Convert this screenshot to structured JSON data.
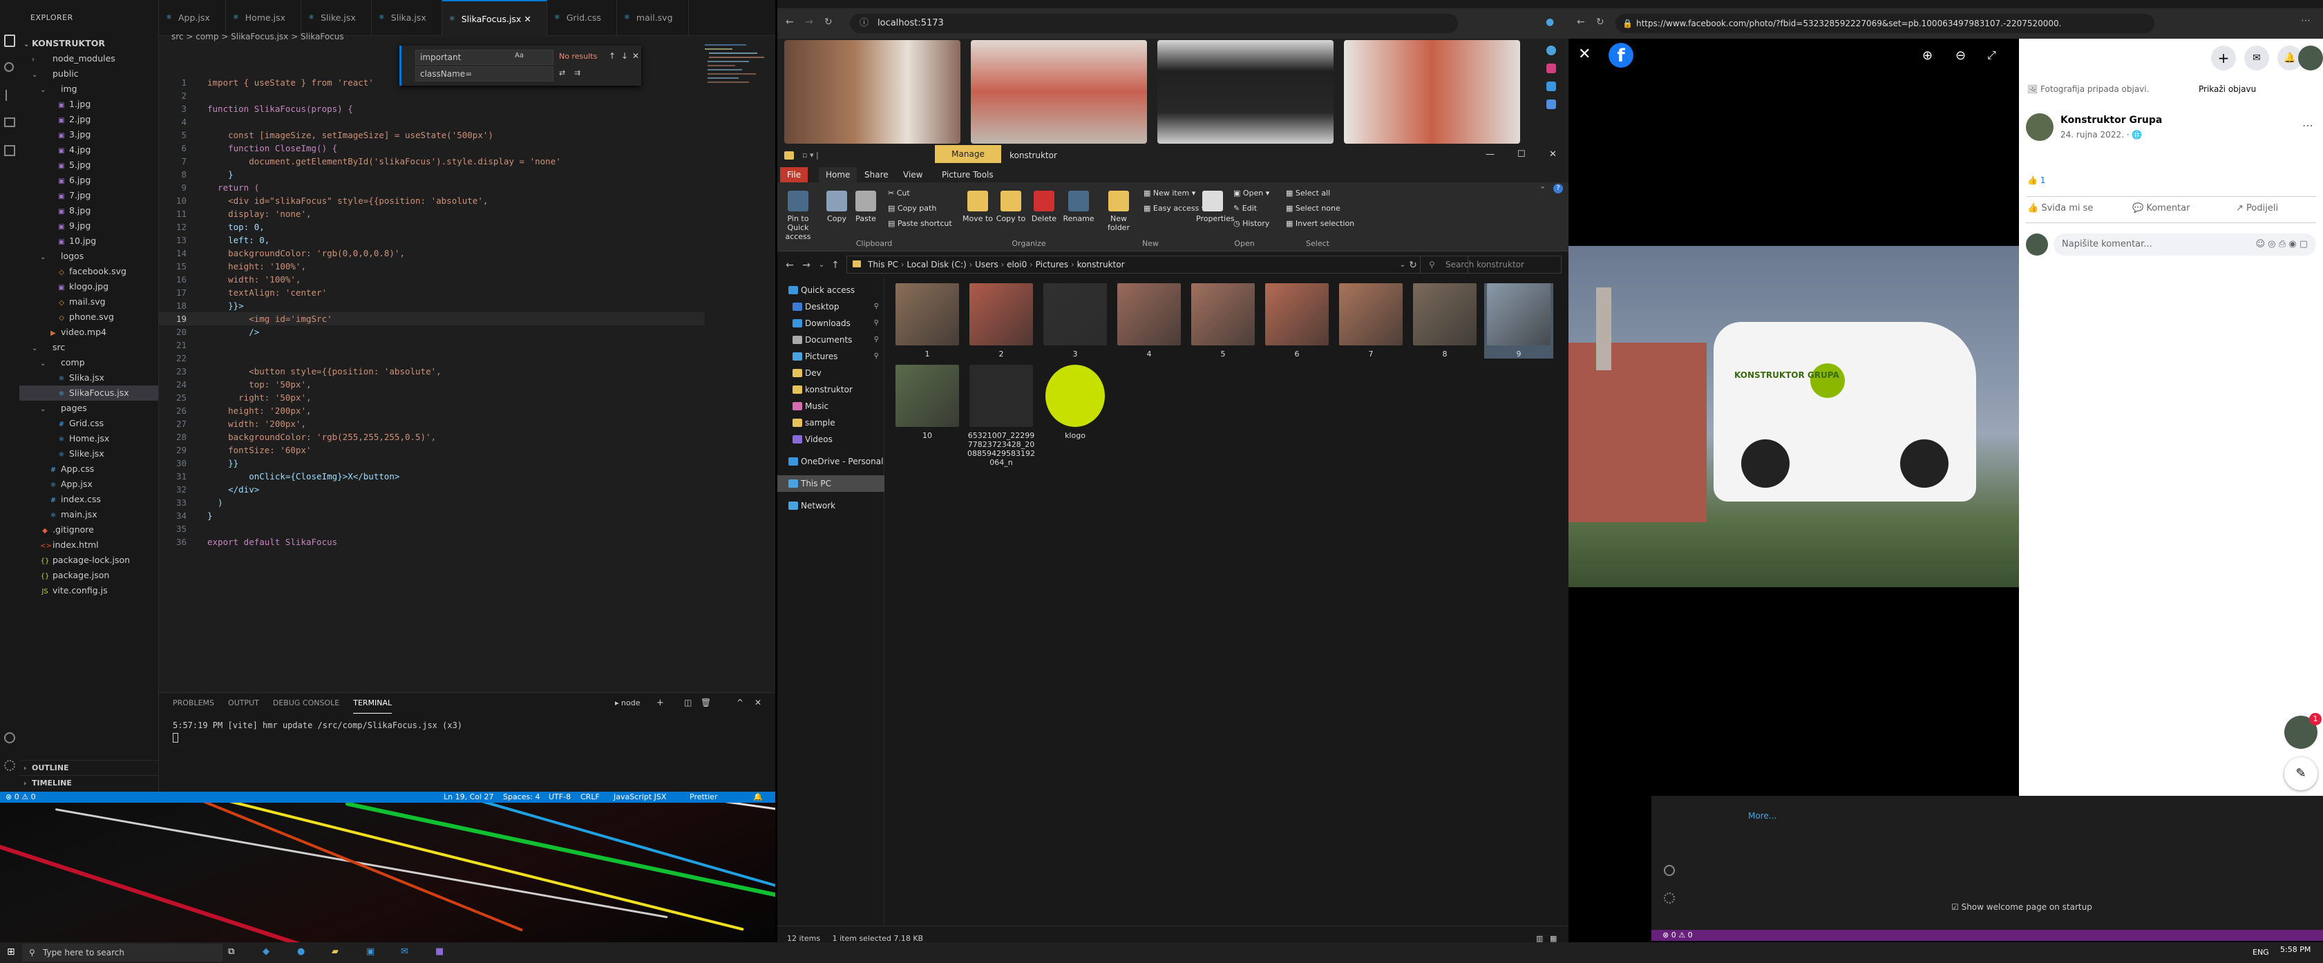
{
  "vscode": {
    "explorer_title": "EXPLORER",
    "project": "KONSTRUKTOR",
    "tree": [
      {
        "label": "node_modules",
        "depth": 1,
        "kind": "folder",
        "open": false
      },
      {
        "label": "public",
        "depth": 1,
        "kind": "folder",
        "open": true
      },
      {
        "label": "img",
        "depth": 2,
        "kind": "folder",
        "open": true
      },
      {
        "label": "1.jpg",
        "depth": 3,
        "kind": "img"
      },
      {
        "label": "2.jpg",
        "depth": 3,
        "kind": "img"
      },
      {
        "label": "3.jpg",
        "depth": 3,
        "kind": "img"
      },
      {
        "label": "4.jpg",
        "depth": 3,
        "kind": "img"
      },
      {
        "label": "5.jpg",
        "depth": 3,
        "kind": "img"
      },
      {
        "label": "6.jpg",
        "depth": 3,
        "kind": "img"
      },
      {
        "label": "7.jpg",
        "depth": 3,
        "kind": "img"
      },
      {
        "label": "8.jpg",
        "depth": 3,
        "kind": "img"
      },
      {
        "label": "9.jpg",
        "depth": 3,
        "kind": "img"
      },
      {
        "label": "10.jpg",
        "depth": 3,
        "kind": "img"
      },
      {
        "label": "logos",
        "depth": 2,
        "kind": "folder",
        "open": true
      },
      {
        "label": "facebook.svg",
        "depth": 3,
        "kind": "svg"
      },
      {
        "label": "klogo.jpg",
        "depth": 3,
        "kind": "img"
      },
      {
        "label": "mail.svg",
        "depth": 3,
        "kind": "svg"
      },
      {
        "label": "phone.svg",
        "depth": 3,
        "kind": "svg"
      },
      {
        "label": "video.mp4",
        "depth": 2,
        "kind": "video"
      },
      {
        "label": "src",
        "depth": 1,
        "kind": "folder",
        "open": true
      },
      {
        "label": "comp",
        "depth": 2,
        "kind": "folder",
        "open": true
      },
      {
        "label": "Slika.jsx",
        "depth": 3,
        "kind": "jsx"
      },
      {
        "label": "SlikaFocus.jsx",
        "depth": 3,
        "kind": "jsx",
        "selected": true
      },
      {
        "label": "pages",
        "depth": 2,
        "kind": "folder",
        "open": true
      },
      {
        "label": "Grid.css",
        "depth": 3,
        "kind": "css"
      },
      {
        "label": "Home.jsx",
        "depth": 3,
        "kind": "jsx"
      },
      {
        "label": "Slike.jsx",
        "depth": 3,
        "kind": "jsx"
      },
      {
        "label": "App.css",
        "depth": 2,
        "kind": "css"
      },
      {
        "label": "App.jsx",
        "depth": 2,
        "kind": "jsx"
      },
      {
        "label": "index.css",
        "depth": 2,
        "kind": "css"
      },
      {
        "label": "main.jsx",
        "depth": 2,
        "kind": "jsx"
      },
      {
        "label": ".gitignore",
        "depth": 1,
        "kind": "git"
      },
      {
        "label": "index.html",
        "depth": 1,
        "kind": "html"
      },
      {
        "label": "package-lock.json",
        "depth": 1,
        "kind": "json"
      },
      {
        "label": "package.json",
        "depth": 1,
        "kind": "json"
      },
      {
        "label": "vite.config.js",
        "depth": 1,
        "kind": "js"
      }
    ],
    "outline_label": "OUTLINE",
    "timeline_label": "TIMELINE",
    "tabs": [
      {
        "label": "App.jsx",
        "active": false
      },
      {
        "label": "Home.jsx",
        "active": false
      },
      {
        "label": "Slike.jsx",
        "active": false
      },
      {
        "label": "Slika.jsx",
        "active": false
      },
      {
        "label": "SlikaFocus.jsx",
        "active": true
      },
      {
        "label": "Grid.css",
        "active": false
      },
      {
        "label": "mail.svg",
        "active": false
      }
    ],
    "breadcrumb": "src > comp > SlikaFocus.jsx > SlikaFocus",
    "find": {
      "query": "important",
      "replace": "className=",
      "result": "No results",
      "aa": "Aa",
      "ab": "ab",
      "re": ".*",
      "all": "AB"
    },
    "code": [
      "import { useState } from 'react'",
      "",
      "function SlikaFocus(props) {",
      "",
      "    const [imageSize, setImageSize] = useState('500px')",
      "    function CloseImg() {",
      "        document.getElementById('slikaFocus').style.display = 'none'",
      "    }",
      "  return (",
      "    <div id=\"slikaFocus\" style={{position: 'absolute',",
      "    display: 'none',",
      "    top: 0,",
      "    left: 0,",
      "    backgroundColor: 'rgb(0,0,0,0.8)',",
      "    height: '100%',",
      "    width: '100%',",
      "    textAlign: 'center'",
      "    }}>",
      "        <img id='imgSrc'",
      "        />",
      "",
      "",
      "        <button style={{position: 'absolute',",
      "        top: '50px',",
      "      right: '50px',",
      "    height: '200px',",
      "    width: '200px',",
      "    backgroundColor: 'rgb(255,255,255,0.5)',",
      "    fontSize: '60px'",
      "    }}",
      "        onClick={CloseImg}>X</button>",
      "    </div>",
      "  )",
      "}",
      "",
      "export default SlikaFocus"
    ],
    "current_line": 19,
    "panel_tabs": [
      "PROBLEMS",
      "OUTPUT",
      "DEBUG CONSOLE",
      "TERMINAL"
    ],
    "panel_active": "TERMINAL",
    "terminal_shell": "node",
    "terminal_line": "5:57:19 PM [vite] hmr update /src/comp/SlikaFocus.jsx (x3)",
    "status": {
      "errors": "0",
      "warnings": "0",
      "position": "Ln 19, Col 27",
      "spaces": "Spaces: 4",
      "encoding": "UTF-8",
      "eol": "CRLF",
      "language": "JavaScript JSX",
      "formatter": "Prettier"
    }
  },
  "browser1": {
    "url": "localhost:5173"
  },
  "explorer": {
    "title": "konstruktor",
    "manage_label": "Manage",
    "menu": [
      "File",
      "Home",
      "Share",
      "View",
      "Picture Tools"
    ],
    "active_menu": "Home",
    "ribbon": {
      "pin": "Pin to Quick access",
      "copy": "Copy",
      "paste": "Paste",
      "cut": "Cut",
      "copy_path": "Copy path",
      "paste_shortcut": "Paste shortcut",
      "move_to": "Move to",
      "copy_to": "Copy to",
      "delete": "Delete",
      "rename": "Rename",
      "new_folder": "New folder",
      "new_item": "New item",
      "easy_access": "Easy access",
      "properties": "Properties",
      "open": "Open",
      "edit": "Edit",
      "history": "History",
      "select_all": "Select all",
      "select_none": "Select none",
      "invert_selection": "Invert selection",
      "groups": [
        "Clipboard",
        "Organize",
        "New",
        "Open",
        "Select"
      ]
    },
    "path": [
      "This PC",
      "Local Disk (C:)",
      "Users",
      "eloi0",
      "Pictures",
      "konstruktor"
    ],
    "search_placeholder": "Search konstruktor",
    "nav": [
      {
        "label": "Quick access",
        "color": "#3a96dd",
        "pin": false,
        "top": true
      },
      {
        "label": "Desktop",
        "color": "#3a7bd5",
        "pin": true
      },
      {
        "label": "Downloads",
        "color": "#3a96dd",
        "pin": true
      },
      {
        "label": "Documents",
        "color": "#aaaaaa",
        "pin": true
      },
      {
        "label": "Pictures",
        "color": "#4aa3df",
        "pin": true
      },
      {
        "label": "Dev",
        "color": "#e8c15a",
        "pin": false
      },
      {
        "label": "konstruktor",
        "color": "#e8c15a",
        "pin": false
      },
      {
        "label": "Music",
        "color": "#d86cb0",
        "pin": false
      },
      {
        "label": "sample",
        "color": "#e8c15a",
        "pin": false
      },
      {
        "label": "Videos",
        "color": "#8a6ad8",
        "pin": false
      },
      {
        "label": "OneDrive - Personal",
        "color": "#3a96dd",
        "pin": false,
        "top": true
      },
      {
        "label": "This PC",
        "color": "#4aa3df",
        "pin": false,
        "top": true,
        "selected": true
      },
      {
        "label": "Network",
        "color": "#4aa3df",
        "pin": false,
        "top": true
      }
    ],
    "files": [
      {
        "label": "1",
        "color": "#8a6e58"
      },
      {
        "label": "2",
        "color": "#b05a4a"
      },
      {
        "label": "3",
        "color": "#303030"
      },
      {
        "label": "4",
        "color": "#9a6a5a"
      },
      {
        "label": "5",
        "color": "#a0705e"
      },
      {
        "label": "6",
        "color": "#b46a52"
      },
      {
        "label": "7",
        "color": "#a8745a"
      },
      {
        "label": "8",
        "color": "#7a6a5a"
      },
      {
        "label": "9",
        "color": "#8a9aaa",
        "selected": true
      },
      {
        "label": "10",
        "color": "#5a6a4a"
      },
      {
        "label": "65321007_2229977823723428_2008859429583192064_n",
        "color": "#2a2a2a"
      },
      {
        "label": "klogo",
        "color": "#c8e000"
      }
    ],
    "status_items": "12 items",
    "status_selected": "1 item selected  7.18 KB"
  },
  "facebook": {
    "url": "https://www.facebook.com/photo/?fbid=532328592227069&set=pb.100063497983107.-2207520000.",
    "photo_caption": "Fotografija pripada objavi.",
    "show_post": "Prikaži objavu",
    "page_name": "Konstruktor Grupa",
    "date": "24. rujna 2022.",
    "likes": "1",
    "like_btn": "Sviđa mi se",
    "comment_btn": "Komentar",
    "share_btn": "Podijeli",
    "comment_placeholder": "Napišite komentar...",
    "notif_count": "1",
    "van_text": "KONSTRUKTOR GRUPA"
  },
  "vscode2": {
    "more": "More...",
    "welcome_label": "Show welcome page on startup",
    "status": "⊗ 0 ⚠ 0"
  },
  "taskbar": {
    "search_placeholder": "Type here to search",
    "time": "5:58 PM",
    "lang": "ENG"
  }
}
